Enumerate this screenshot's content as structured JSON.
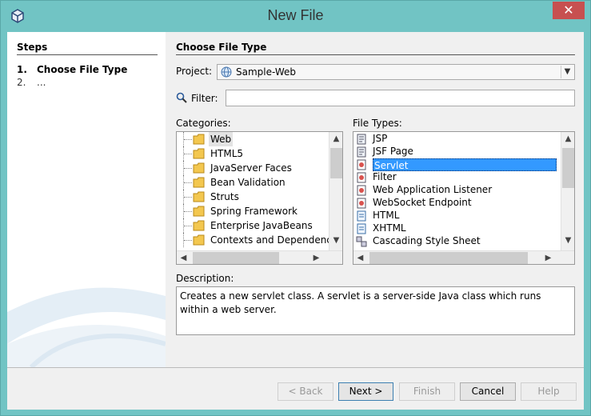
{
  "window": {
    "title": "New File",
    "close_glyph": "✕",
    "app_icon": "netbeans-cube-icon"
  },
  "steps": {
    "title": "Steps",
    "items": [
      {
        "num": "1.",
        "label": "Choose File Type"
      },
      {
        "num": "2.",
        "label": "..."
      }
    ]
  },
  "main": {
    "title": "Choose File Type",
    "project_label": "Project:",
    "project_value": "Sample-Web",
    "filter_label": "Filter:",
    "filter_value": "",
    "categories_label": "Categories:",
    "filetypes_label": "File Types:",
    "categories": [
      {
        "label": "Web",
        "selected": true
      },
      {
        "label": "HTML5"
      },
      {
        "label": "JavaServer Faces"
      },
      {
        "label": "Bean Validation"
      },
      {
        "label": "Struts"
      },
      {
        "label": "Spring Framework"
      },
      {
        "label": "Enterprise JavaBeans"
      },
      {
        "label": "Contexts and Dependenc"
      }
    ],
    "file_types": [
      {
        "label": "JSP"
      },
      {
        "label": "JSF Page"
      },
      {
        "label": "Servlet",
        "selected": true
      },
      {
        "label": "Filter"
      },
      {
        "label": "Web Application Listener"
      },
      {
        "label": "WebSocket Endpoint"
      },
      {
        "label": "HTML"
      },
      {
        "label": "XHTML"
      },
      {
        "label": "Cascading Style Sheet"
      }
    ],
    "description_label": "Description:",
    "description": "Creates a new servlet class. A servlet is a server-side Java class which runs within a web server."
  },
  "buttons": {
    "back": "< Back",
    "next": "Next >",
    "finish": "Finish",
    "cancel": "Cancel",
    "help": "Help"
  },
  "colors": {
    "titlebar": "#71c4c4",
    "close": "#c75050",
    "selection": "#3399ff"
  }
}
